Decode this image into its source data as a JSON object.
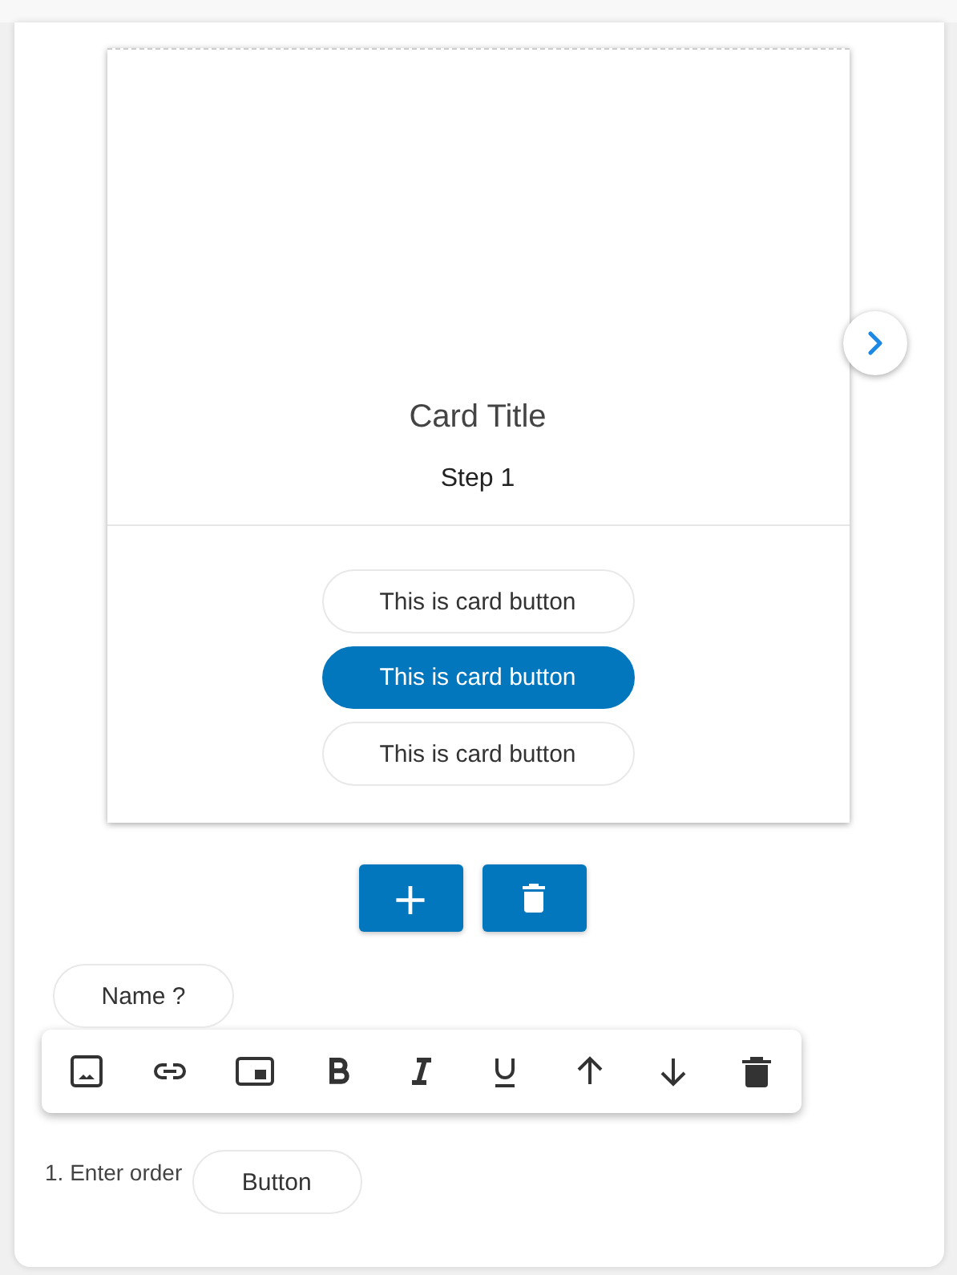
{
  "card": {
    "title": "Card Title",
    "subtitle": "Step 1",
    "buttons": [
      {
        "label": "This is card button",
        "selected": false
      },
      {
        "label": "This is card button",
        "selected": true
      },
      {
        "label": "This is card button",
        "selected": false
      }
    ]
  },
  "actions": [
    {
      "kind": "add",
      "label": "+"
    },
    {
      "kind": "delete"
    }
  ],
  "name_chip": "Name ?",
  "order": {
    "label": "1. Enter order",
    "button": "Button"
  }
}
